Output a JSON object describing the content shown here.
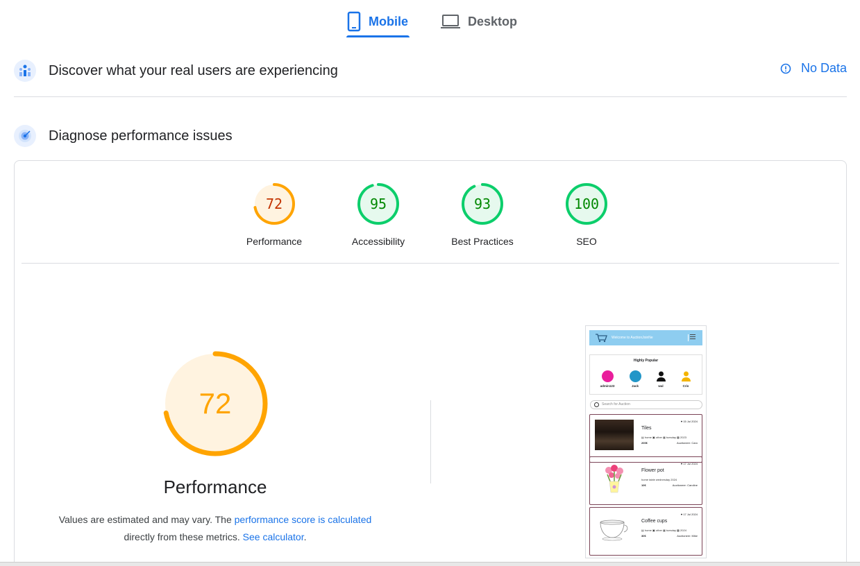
{
  "tabs": {
    "mobile_label": "Mobile",
    "desktop_label": "Desktop",
    "active": "Mobile"
  },
  "discover": {
    "title": "Discover what your real users are experiencing",
    "status_label": "No Data",
    "icon": "users-chart-icon"
  },
  "diagnose": {
    "title": "Diagnose performance issues",
    "icon": "radar-icon"
  },
  "scores": [
    {
      "label": "Performance",
      "value": "72",
      "score": 72,
      "status": "average"
    },
    {
      "label": "Accessibility",
      "value": "95",
      "score": 95,
      "status": "pass"
    },
    {
      "label": "Best Practices",
      "value": "93",
      "score": 93,
      "status": "pass"
    },
    {
      "label": "SEO",
      "value": "100",
      "score": 100,
      "status": "pass"
    }
  ],
  "performance": {
    "score": "72",
    "score_value": 72,
    "title": "Performance",
    "desc_prefix": "Values are estimated and may vary. The ",
    "desc_link1": "performance score is calculated",
    "desc_middle": " directly from these metrics. ",
    "desc_link2": "See calculator",
    "desc_suffix": "."
  },
  "screenshot": {
    "header_text": "Welcome to AuctionJoinNe",
    "popular_title": "Highly Popular",
    "users": [
      {
        "name": "admin123",
        "color": "#e91e9c"
      },
      {
        "name": "Jack",
        "color": "#2196c8"
      },
      {
        "name": "wal",
        "color": "#111111"
      },
      {
        "name": "Cris",
        "color": "#f4b400"
      }
    ],
    "search_placeholder": "Search for Auction",
    "items": [
      {
        "date": "♥ 15 Jul 2024",
        "name": "Tiles",
        "meta": "▤ home ▣ other ▦ tuesday ▩ 2023",
        "price": "200€",
        "auctioneer": "Auctioneer: Caro"
      },
      {
        "date": "♥ 17 Jul 2024",
        "name": "Flower pot",
        "meta": "home  table  wednesday  2024",
        "price": "10€",
        "auctioneer": "Auctioneer: Caroline"
      },
      {
        "date": "♥ 17 Jul 2024",
        "name": "Coffee cups",
        "meta": "▤ home ▣ other ▦ tuesday ▩ 2024",
        "price": "30€",
        "auctioneer": "Auctioneer: Mike"
      }
    ]
  },
  "colors": {
    "accent": "#1a73e8",
    "average": "#ffa400",
    "average_text": "#c33300",
    "average_bg": "#fff3e0",
    "pass": "#0cce6b",
    "pass_text": "#008800",
    "pass_bg": "#e6f9ee"
  }
}
